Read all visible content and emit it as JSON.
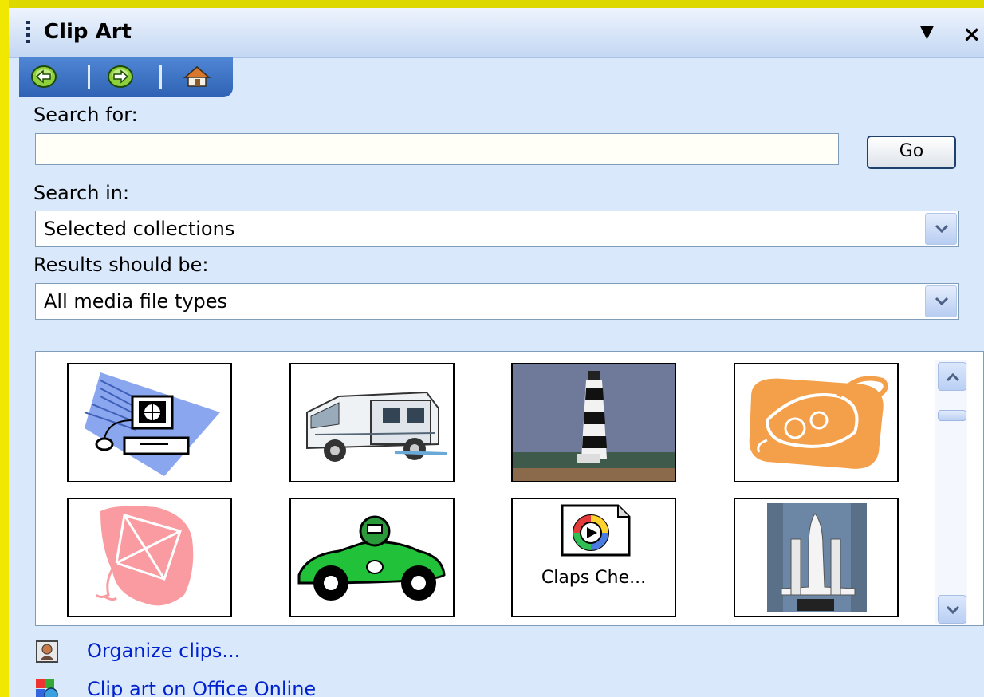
{
  "panel": {
    "title": "Clip Art",
    "menu_icon": "dropdown-triangle-icon",
    "close_icon": "close-x-icon"
  },
  "navigation": {
    "back_icon": "back-arrow-icon",
    "forward_icon": "forward-arrow-icon",
    "home_icon": "home-icon"
  },
  "search": {
    "search_for_label": "Search for:",
    "search_for_value": "",
    "go_label": "Go",
    "search_in_label": "Search in:",
    "search_in_value": "Selected collections",
    "results_label": "Results should be:",
    "results_value": "All media file types"
  },
  "results": {
    "items": [
      {
        "name": "computer-network-clipart"
      },
      {
        "name": "ambulance-clipart"
      },
      {
        "name": "lighthouse-photo"
      },
      {
        "name": "cornucopia-clipart"
      },
      {
        "name": "kite-clipart"
      },
      {
        "name": "race-car-clipart"
      },
      {
        "name": "sound-clip",
        "caption": "Claps Che..."
      },
      {
        "name": "space-shuttle-photo"
      }
    ]
  },
  "links": {
    "organize": "Organize clips...",
    "online": "Clip art on Office Online"
  },
  "colors": {
    "pane_bg": "#d9e8fb",
    "link": "#0021ce",
    "nav_bar": "#3a6fc0",
    "outer_frame": "#e8e400"
  }
}
